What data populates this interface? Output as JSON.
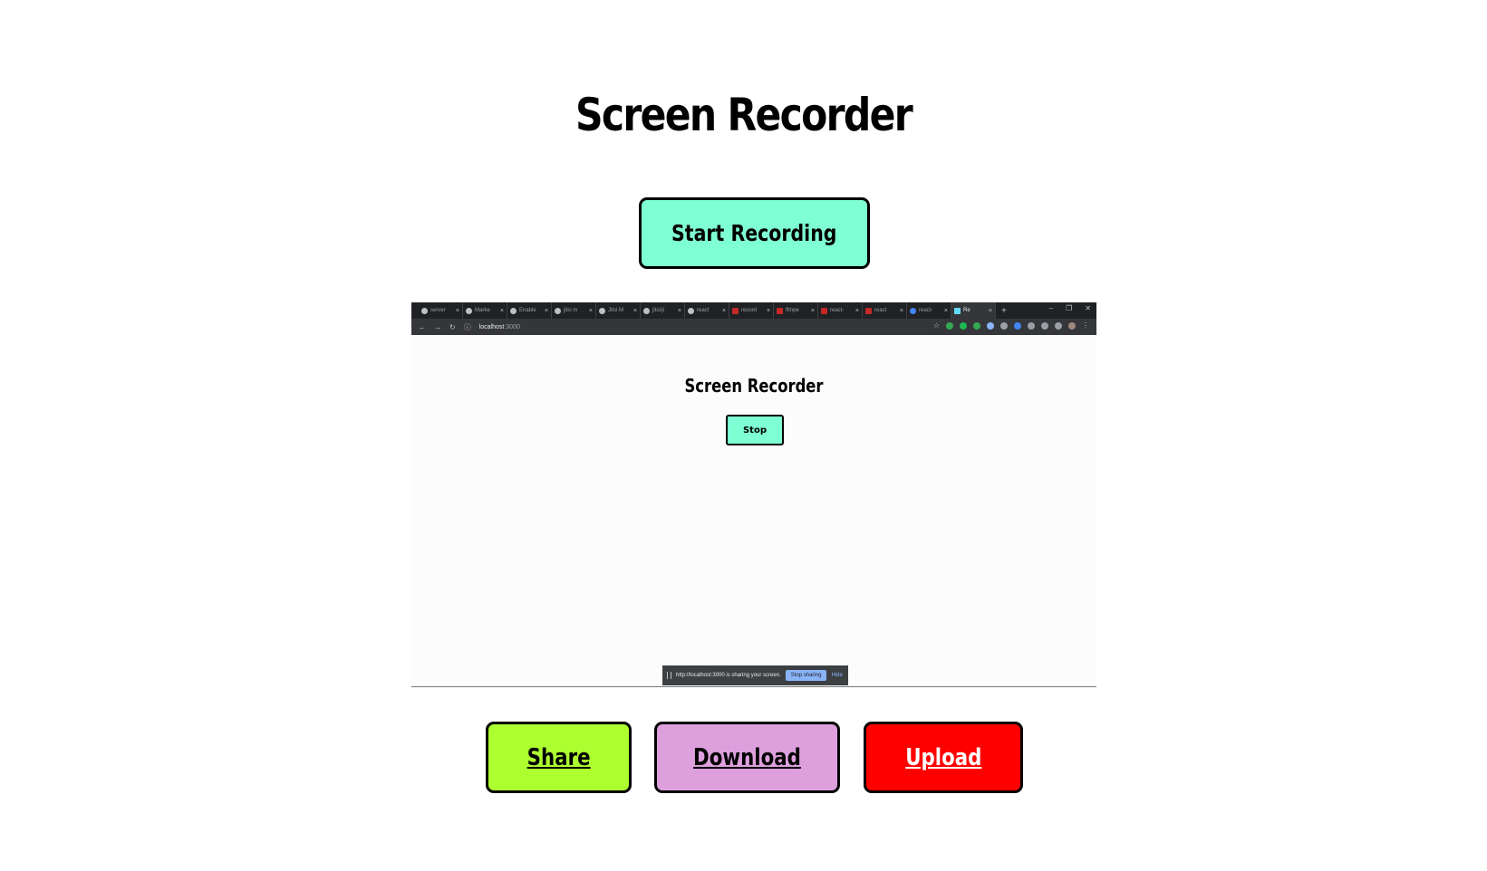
{
  "app": {
    "title": "Screen Recorder",
    "start_label": "Start Recording"
  },
  "actions": {
    "share_label": "Share",
    "download_label": "Download",
    "upload_label": "Upload"
  },
  "colors": {
    "start": "#7fffd4",
    "share": "#adff2f",
    "download": "#dda0dd",
    "upload": "#ff0000"
  },
  "preview": {
    "tabs": [
      {
        "label": "server",
        "icon": "github-icon"
      },
      {
        "label": "Marke",
        "icon": "globe-icon"
      },
      {
        "label": "Enable",
        "icon": "page-icon"
      },
      {
        "label": "jitsi m",
        "icon": "google-icon"
      },
      {
        "label": "Jitsi M",
        "icon": "page-icon"
      },
      {
        "label": "jitsi/ji",
        "icon": "github-icon"
      },
      {
        "label": "react",
        "icon": "google-icon"
      },
      {
        "label": "record",
        "icon": "npm-icon"
      },
      {
        "label": "ffmpe",
        "icon": "npm-icon"
      },
      {
        "label": "react-",
        "icon": "npm-icon"
      },
      {
        "label": "react",
        "icon": "npm-icon"
      },
      {
        "label": "react-",
        "icon": "star-icon"
      },
      {
        "label": "Re",
        "icon": "react-icon"
      }
    ],
    "url_host": "localhost",
    "url_port": ":3000",
    "inner_title": "Screen Recorder",
    "inner_stop_label": "Stop",
    "sharing_text": "http://localhost:3000 is sharing your screen.",
    "stop_sharing_label": "Stop sharing",
    "hide_label": "Hide"
  }
}
